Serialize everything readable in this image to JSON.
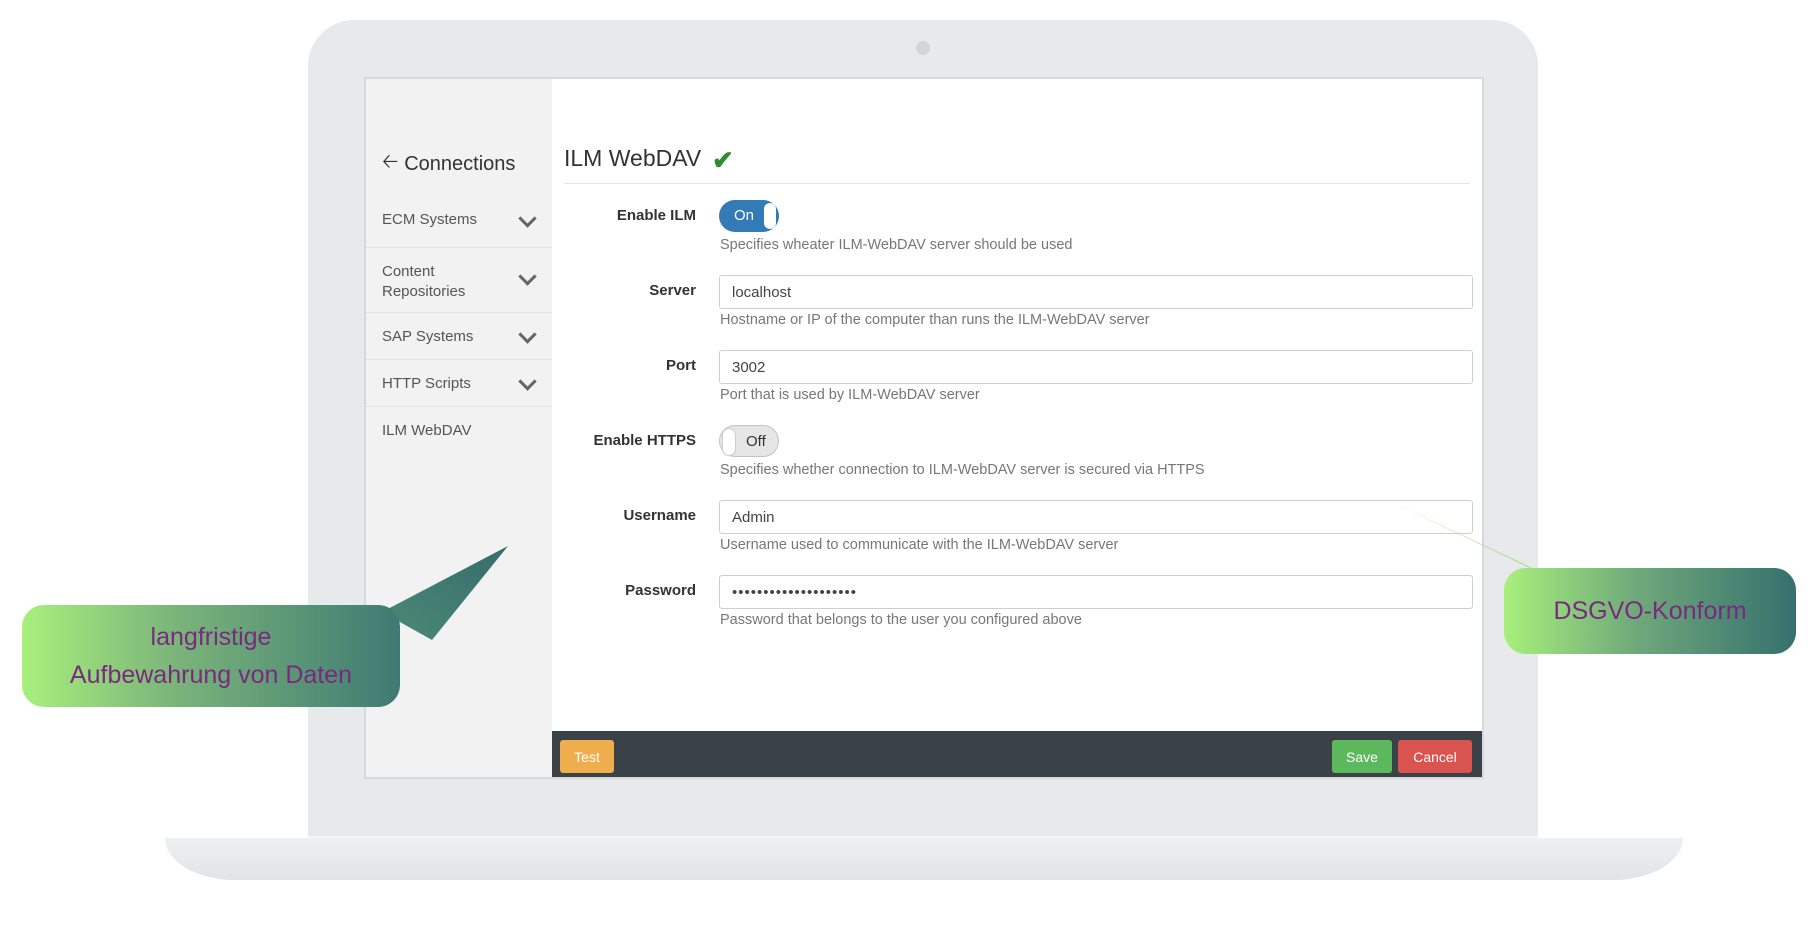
{
  "sidebar": {
    "back_label": "Connections",
    "items": [
      {
        "label": "ECM Systems",
        "expandable": true
      },
      {
        "label": "Content Repositories",
        "expandable": true
      },
      {
        "label": "SAP Systems",
        "expandable": true
      },
      {
        "label": "HTTP Scripts",
        "expandable": true
      },
      {
        "label": "ILM WebDAV",
        "expandable": false
      }
    ]
  },
  "form": {
    "title": "ILM WebDAV",
    "status_icon": "check-icon",
    "enable_ilm": {
      "label": "Enable ILM",
      "state": "On",
      "help": "Specifies wheater ILM-WebDAV server should be used"
    },
    "server": {
      "label": "Server",
      "value": "localhost",
      "help": "Hostname or IP of the computer than runs the ILM-WebDAV server"
    },
    "port": {
      "label": "Port",
      "value": "3002",
      "help": "Port that is used by ILM-WebDAV server"
    },
    "enable_https": {
      "label": "Enable HTTPS",
      "state": "Off",
      "help": "Specifies whether connection to ILM-WebDAV server is secured via HTTPS"
    },
    "username": {
      "label": "Username",
      "value": "Admin",
      "help": "Username used to communicate with the ILM-WebDAV server"
    },
    "password": {
      "label": "Password",
      "value": "••••••••••••••••••••",
      "help": "Password that belongs to the user you configured above"
    }
  },
  "footer": {
    "test_label": "Test",
    "save_label": "Save",
    "cancel_label": "Cancel"
  },
  "callouts": {
    "left_line1": "langfristige",
    "left_line2": "Aufbewahrung von Daten",
    "right": "DSGVO-Konform"
  },
  "colors": {
    "accent": "#337ab7",
    "success": "#5cb85c",
    "danger": "#d9534f",
    "warning": "#f0ad4e",
    "footer_bg": "#3a4248",
    "callout_text": "#7a2a7e"
  }
}
